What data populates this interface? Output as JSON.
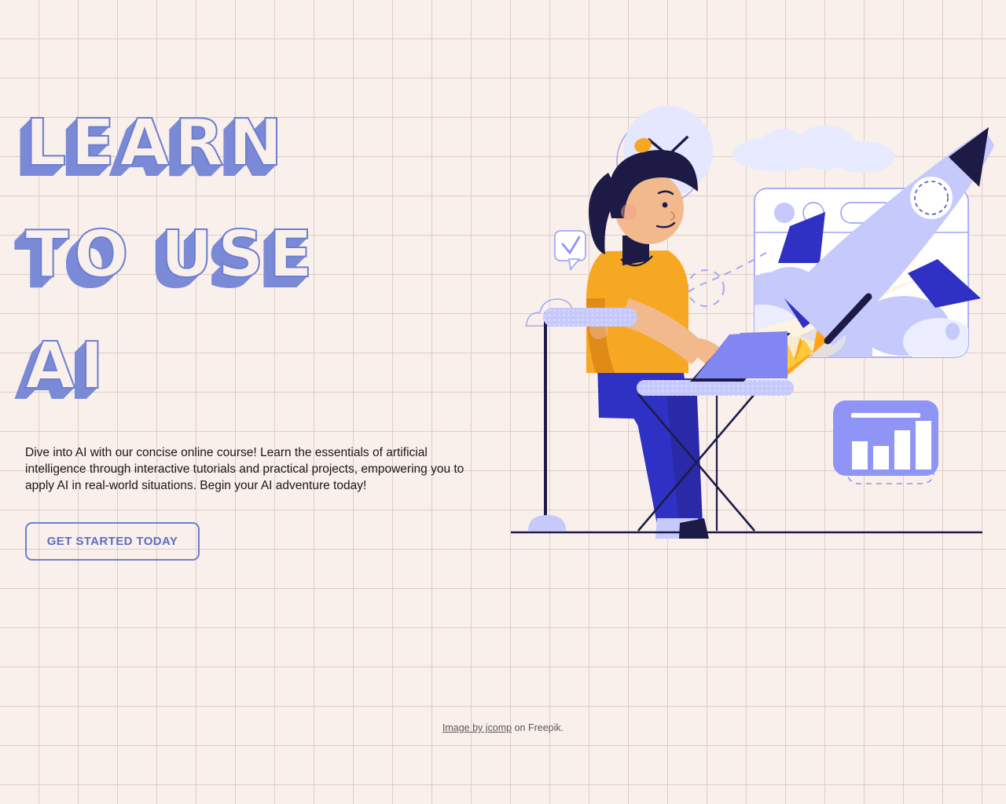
{
  "theme": {
    "page_background": "#f9efeb",
    "grid_line": "#dfcdc4",
    "headline_blue": "#7b8ad6",
    "accent_blue": "#6b7fd0",
    "periwinkle": "#a3a9f5",
    "deep_blue": "#2f31c4",
    "navy": "#1d1b46",
    "orange": "#f7a823",
    "pale_lavender": "#e8eaff",
    "body_text": "#18181b",
    "credit_text": "#5b5b5b"
  },
  "hero": {
    "headline": "LEARN\nTO USE\nAI",
    "headline_lines": [
      "LEARN",
      "TO USE",
      "AI"
    ],
    "subhead": "Dive into AI with our concise online course! Learn the essentials of artificial intelligence through interactive tutorials and practical projects, empowering you to apply AI in real-world situations. Begin your AI adventure today!",
    "cta_label": "GET STARTED TODAY"
  },
  "credit": {
    "link_text": "Image by jcomp",
    "suffix_text": " on Freepik."
  },
  "illustration": {
    "alt": "Woman working on a laptop with a rocket launching from a browser window",
    "elements": [
      "clock-circle",
      "outline-circle",
      "filled-cloud",
      "outline-cloud",
      "speech-bubble-check",
      "browser-window",
      "rocket",
      "person-at-laptop",
      "stool",
      "desk",
      "chart-card",
      "dashed-swoosh",
      "floor-line"
    ],
    "chart_card": {
      "bars": [
        4,
        3,
        6,
        8
      ],
      "bar_color": "#ffffff",
      "card_color": "#8f95f6"
    },
    "browser_window": {
      "dots": 2,
      "address_bar": true
    }
  }
}
